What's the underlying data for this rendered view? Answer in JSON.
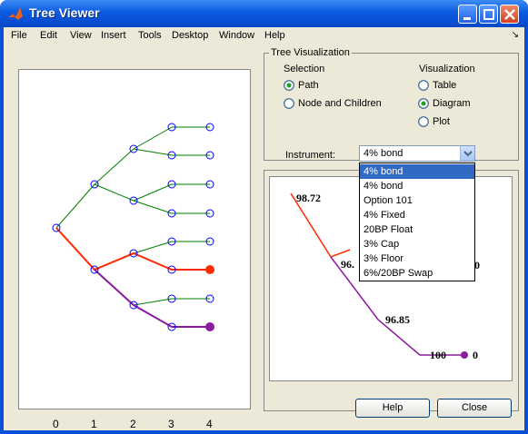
{
  "window": {
    "title": "Tree Viewer"
  },
  "menu": [
    "File",
    "Edit",
    "View",
    "Insert",
    "Tools",
    "Desktop",
    "Window",
    "Help"
  ],
  "tree_plot": {
    "x_ticks": [
      "0",
      "1",
      "2",
      "3",
      "4"
    ]
  },
  "visualization_panel": {
    "title": "Tree Visualization",
    "selection_head": "Selection",
    "visualization_head": "Visualization",
    "selection_options": [
      {
        "label": "Path",
        "checked": true
      },
      {
        "label": "Node and Children",
        "checked": false
      }
    ],
    "visualization_options": [
      {
        "label": "Table",
        "checked": false
      },
      {
        "label": "Diagram",
        "checked": true
      },
      {
        "label": "Plot",
        "checked": false
      }
    ]
  },
  "instrument": {
    "label": "Instrument:",
    "value": "4% bond",
    "options": [
      "4% bond",
      "4% bond",
      "Option 101",
      "4% Fixed",
      "20BP Float",
      "3% Cap",
      "3% Floor",
      "6%/20BP Swap"
    ]
  },
  "diagram": {
    "labels": [
      "98.72",
      "96.",
      "0",
      "96.85",
      "100",
      "0"
    ]
  },
  "buttons": {
    "help": "Help",
    "close": "Close"
  },
  "colors": {
    "titlebar": "#0b5ae0",
    "tree_green": "#008000",
    "tree_red": "#ff2a00",
    "tree_purple": "#8b1a9e",
    "node_blue": "#0000ff",
    "selection_blue": "#316ac5"
  }
}
